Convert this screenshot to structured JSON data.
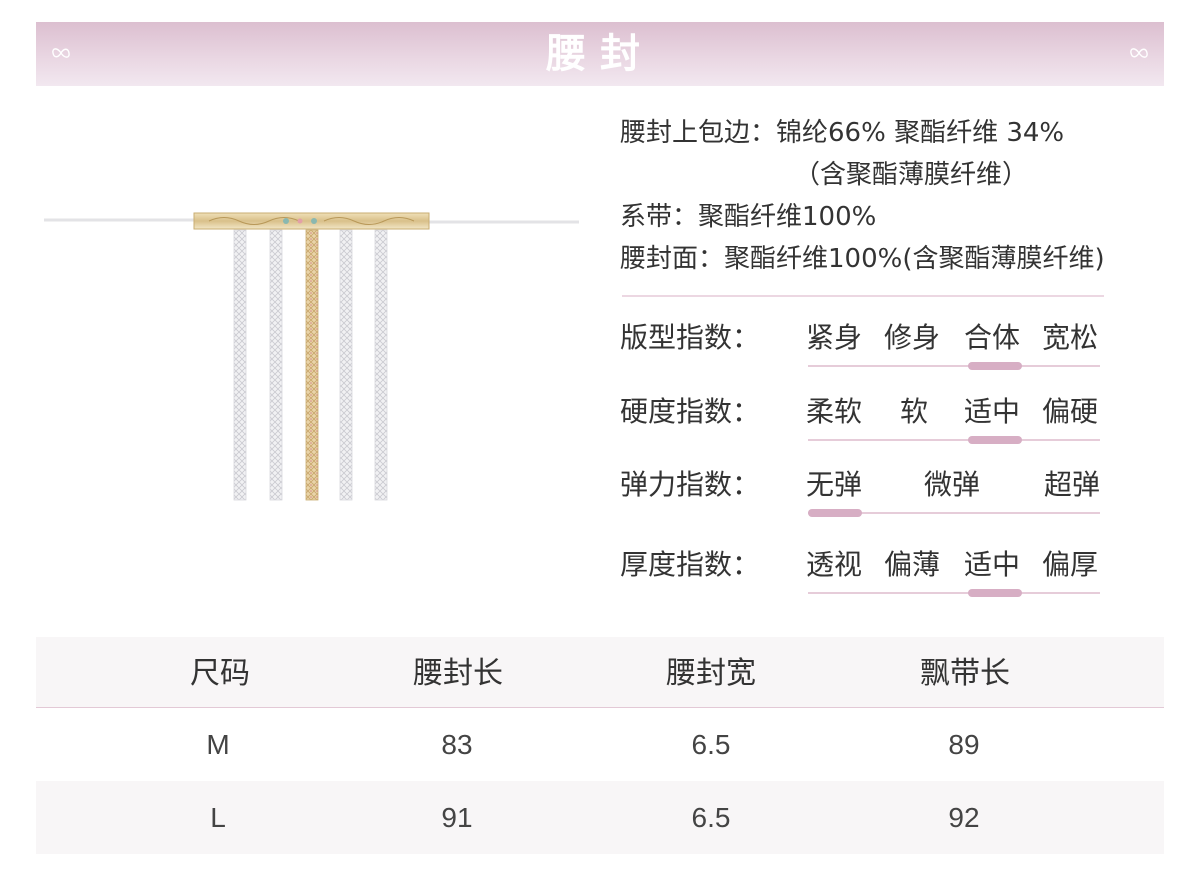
{
  "header": {
    "title": "腰封"
  },
  "colors": {
    "banner": "#dcbfd0",
    "accent": "#d7aec4",
    "track": "#e6ccd9",
    "row_alt": "#f8f6f7"
  },
  "materials": [
    {
      "label": "腰封上包边：",
      "value": "锦纶66% 聚酯纤维 34%"
    },
    {
      "label": "",
      "value": "（含聚酯薄膜纤维）"
    },
    {
      "label": "系带：",
      "value": "聚酯纤维100%"
    },
    {
      "label": "腰封面：",
      "value": "聚酯纤维100%(含聚酯薄膜纤维)"
    }
  ],
  "indices": [
    {
      "label": "版型指数：",
      "options": [
        "紧身",
        "修身",
        "合体",
        "宽松"
      ],
      "selected": "合体"
    },
    {
      "label": "硬度指数：",
      "options": [
        "柔软",
        "软",
        "适中",
        "偏硬"
      ],
      "selected": "适中"
    },
    {
      "label": "弹力指数：",
      "options": [
        "无弹",
        "微弹",
        "超弹"
      ],
      "selected": "无弹"
    },
    {
      "label": "厚度指数：",
      "options": [
        "透视",
        "偏薄",
        "适中",
        "偏厚"
      ],
      "selected": "适中"
    }
  ],
  "size_table": {
    "headers": [
      "尺码",
      "腰封长",
      "腰封宽",
      "飘带长"
    ],
    "rows": [
      [
        "M",
        "83",
        "6.5",
        "89"
      ],
      [
        "L",
        "91",
        "6.5",
        "92"
      ]
    ]
  }
}
